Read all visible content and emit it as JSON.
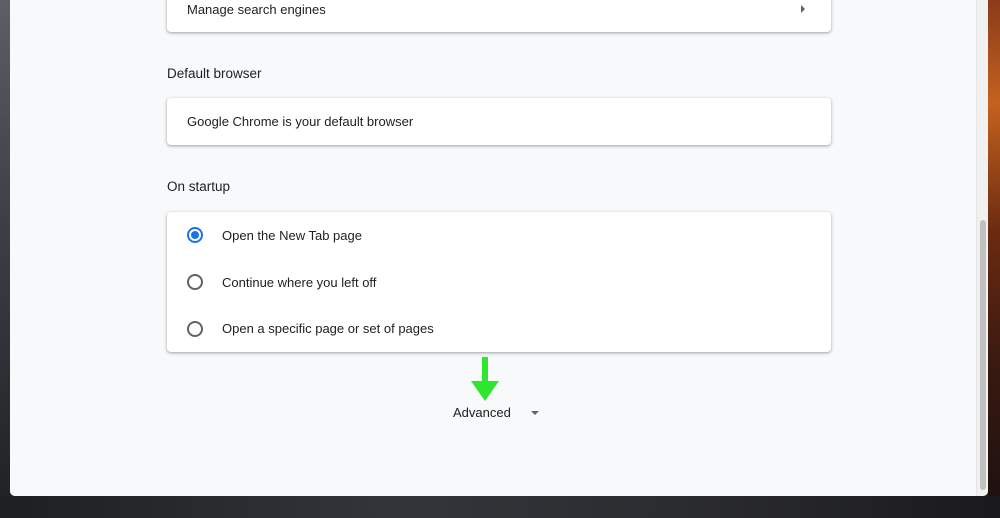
{
  "search_engine": {
    "manage_label": "Manage search engines"
  },
  "default_browser": {
    "title": "Default browser",
    "status": "Google Chrome is your default browser"
  },
  "on_startup": {
    "title": "On startup",
    "options": [
      {
        "label": "Open the New Tab page",
        "selected": true
      },
      {
        "label": "Continue where you left off",
        "selected": false
      },
      {
        "label": "Open a specific page or set of pages",
        "selected": false
      }
    ]
  },
  "advanced": {
    "label": "Advanced"
  },
  "colors": {
    "accent": "#1a73e8",
    "annotation_arrow": "#2ee62e"
  }
}
